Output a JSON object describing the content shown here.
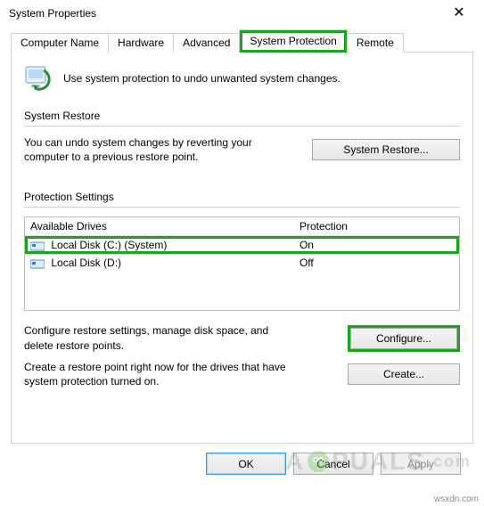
{
  "window": {
    "title": "System Properties"
  },
  "tabs": {
    "computer_name": "Computer Name",
    "hardware": "Hardware",
    "advanced": "Advanced",
    "system_protection": "System Protection",
    "remote": "Remote"
  },
  "intro": {
    "text": "Use system protection to undo unwanted system changes."
  },
  "system_restore": {
    "heading": "System Restore",
    "description": "You can undo system changes by reverting your computer to a previous restore point.",
    "button": "System Restore..."
  },
  "protection_settings": {
    "heading": "Protection Settings",
    "columns": {
      "drives": "Available Drives",
      "protection": "Protection"
    },
    "drives": [
      {
        "icon": "drive-icon",
        "label": "Local Disk (C:) (System)",
        "protection": "On"
      },
      {
        "icon": "drive-icon",
        "label": "Local Disk (D:)",
        "protection": "Off"
      }
    ],
    "configure": {
      "description": "Configure restore settings, manage disk space, and delete restore points.",
      "button": "Configure..."
    },
    "create": {
      "description": "Create a restore point right now for the drives that have system protection turned on.",
      "button": "Create..."
    }
  },
  "dialog_buttons": {
    "ok": "OK",
    "cancel": "Cancel",
    "apply": "Apply"
  },
  "watermark": {
    "brand_left": "A",
    "brand_right": "PUALS",
    "suffix": ".com",
    "footer": "wsxdn.com"
  },
  "highlights": {
    "color": "#1fa21f"
  }
}
